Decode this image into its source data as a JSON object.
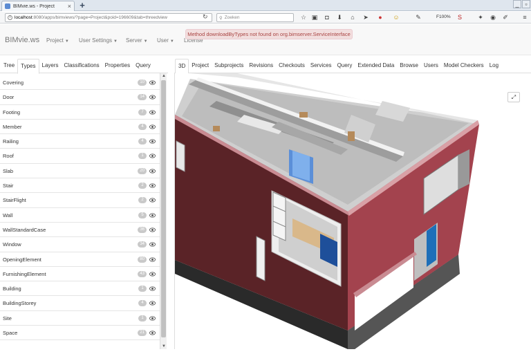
{
  "browser": {
    "tab_title": "BIMvie.ws - Project",
    "url_host": "localhost",
    "url_rest": ":8080/apps/bimviews/?page=Project&poid=196609&tab=threedview",
    "search_placeholder": "Zoeken",
    "zoom": "F100%"
  },
  "app": {
    "brand": "BIMvie.ws",
    "menus": [
      "Project",
      "User Settings",
      "Server",
      "User"
    ],
    "license": "License",
    "alert": "Method downloadByTypes not found on org.bimserver.ServiceInterface"
  },
  "left_tabs": [
    "Tree",
    "Types",
    "Layers",
    "Classifications",
    "Properties",
    "Query"
  ],
  "left_active_tab": "Types",
  "types": [
    {
      "name": "Covering",
      "count": "10"
    },
    {
      "name": "Door",
      "count": "14"
    },
    {
      "name": "Footing",
      "count": "7"
    },
    {
      "name": "Member",
      "count": "4"
    },
    {
      "name": "Railing",
      "count": "4"
    },
    {
      "name": "Roof",
      "count": "1"
    },
    {
      "name": "Slab",
      "count": "20"
    },
    {
      "name": "Stair",
      "count": "2"
    },
    {
      "name": "StairFlight",
      "count": "2"
    },
    {
      "name": "Wall",
      "count": "5"
    },
    {
      "name": "WallStandardCase",
      "count": "36"
    },
    {
      "name": "Window",
      "count": "34"
    },
    {
      "name": "OpeningElement",
      "count": "80"
    },
    {
      "name": "FurnishingElement",
      "count": "43"
    },
    {
      "name": "Building",
      "count": "1"
    },
    {
      "name": "BuildingStorey",
      "count": "4"
    },
    {
      "name": "Site",
      "count": "1"
    },
    {
      "name": "Space",
      "count": "21"
    }
  ],
  "right_tabs": [
    "3D",
    "Project",
    "Subprojects",
    "Revisions",
    "Checkouts",
    "Services",
    "Query",
    "Extended Data",
    "Browse",
    "Users",
    "Model Checkers",
    "Log"
  ],
  "right_active_tab": "3D",
  "colors": {
    "wall_front": "#5a2327",
    "wall_side": "#a3434e",
    "floor_gray": "#d2d2d2",
    "base_dark": "#2a2a2a",
    "alert_bg": "#f2dede",
    "alert_text": "#a94442"
  }
}
